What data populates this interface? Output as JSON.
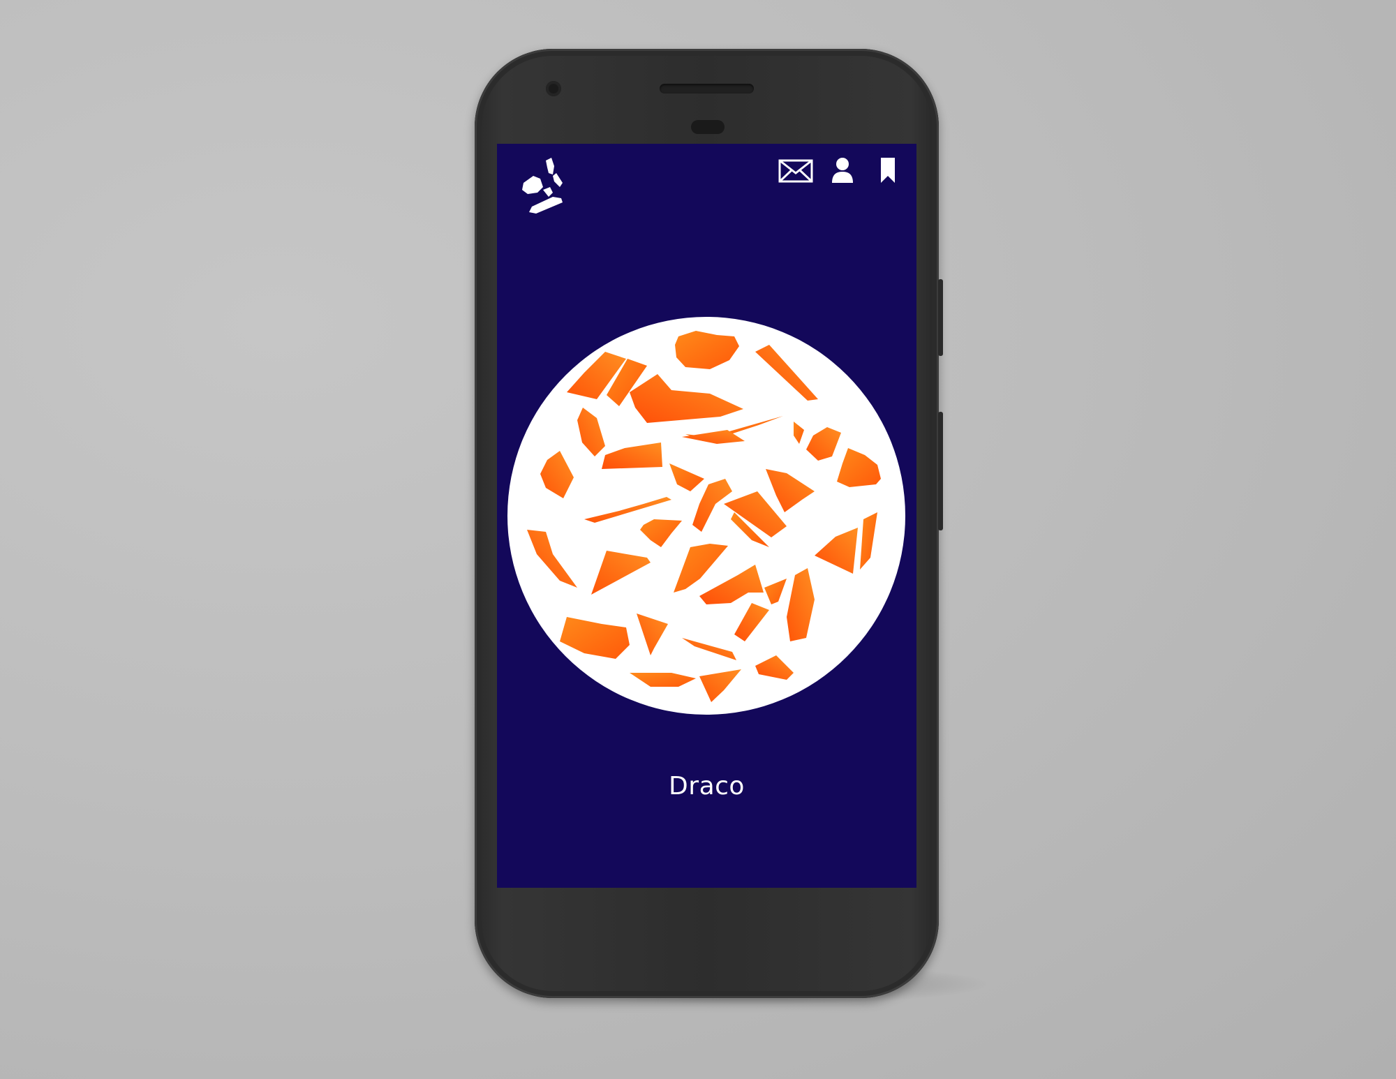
{
  "screen": {
    "background_color": "#13085a",
    "accent_color": "#ff6a10",
    "title": "Draco"
  },
  "header": {
    "logo_icon": "shard-logo-icon",
    "actions": [
      {
        "icon": "envelope-icon"
      },
      {
        "icon": "user-icon"
      },
      {
        "icon": "bookmark-icon"
      }
    ]
  }
}
